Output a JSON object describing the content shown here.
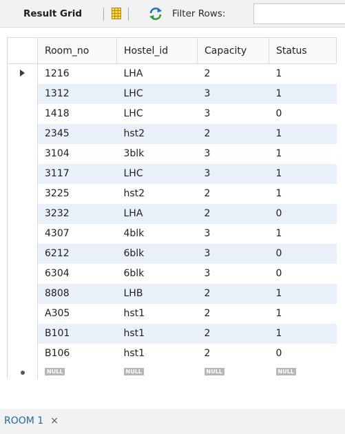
{
  "toolbar": {
    "label": "Result Grid",
    "filter_label": "Filter Rows:",
    "filter_value": "",
    "icons": [
      "grid-layout-icon",
      "refresh-icon"
    ]
  },
  "grid": {
    "columns": [
      "Room_no",
      "Hostel_id",
      "Capacity",
      "Status"
    ],
    "rows": [
      [
        "1216",
        "LHA",
        "2",
        "1"
      ],
      [
        "1312",
        "LHC",
        "3",
        "1"
      ],
      [
        "1418",
        "LHC",
        "3",
        "0"
      ],
      [
        "2345",
        "hst2",
        "2",
        "1"
      ],
      [
        "3104",
        "3blk",
        "3",
        "1"
      ],
      [
        "3117",
        "LHC",
        "3",
        "1"
      ],
      [
        "3225",
        "hst2",
        "2",
        "1"
      ],
      [
        "3232",
        "LHA",
        "2",
        "0"
      ],
      [
        "4307",
        "4blk",
        "3",
        "1"
      ],
      [
        "6212",
        "6blk",
        "3",
        "0"
      ],
      [
        "6304",
        "6blk",
        "3",
        "0"
      ],
      [
        "8808",
        "LHB",
        "2",
        "1"
      ],
      [
        "A305",
        "hst1",
        "2",
        "1"
      ],
      [
        "B101",
        "hst1",
        "2",
        "1"
      ],
      [
        "B106",
        "hst1",
        "2",
        "0"
      ]
    ],
    "null_row": [
      "NULL",
      "NULL",
      "NULL",
      "NULL"
    ],
    "current_row_index": 0
  },
  "tabs": [
    {
      "label": "ROOM 1",
      "close": "×"
    }
  ],
  "colors": {
    "row_alt": "#e9f0fa",
    "toolbar_bg": "#f2f2f2",
    "tab_text": "#1f6aa5"
  }
}
